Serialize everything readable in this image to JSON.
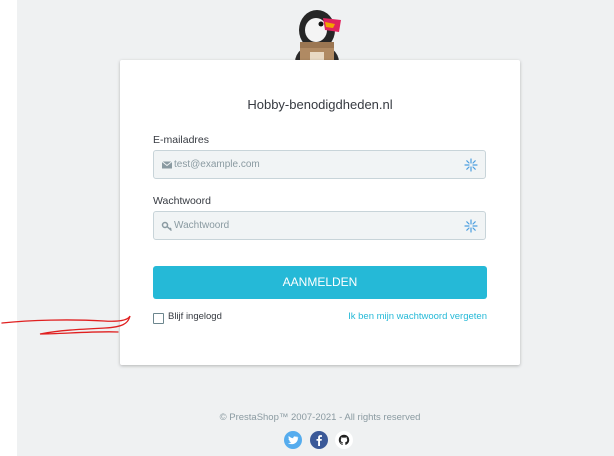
{
  "shop": {
    "name": "Hobby-benodigdheden.nl"
  },
  "login": {
    "email_label": "E-mailadres",
    "email_placeholder": "test@example.com",
    "password_label": "Wachtwoord",
    "password_placeholder": "Wachtwoord",
    "submit_label": "AANMELDEN",
    "remember_label": "Blijf ingelogd",
    "remember_checked": false,
    "forgot_link": "Ik ben mijn wachtwoord vergeten"
  },
  "footer": {
    "copyright": "© PrestaShop™ 2007-2021 - All rights reserved"
  },
  "social": [
    {
      "icon": "twitter-icon",
      "color": "#55acee"
    },
    {
      "icon": "facebook-icon",
      "color": "#3b5998"
    },
    {
      "icon": "github-icon",
      "color": "#ffffff"
    }
  ],
  "colors": {
    "accent": "#25b9d7",
    "background": "#eff1f2",
    "annotation": "#e02020"
  }
}
